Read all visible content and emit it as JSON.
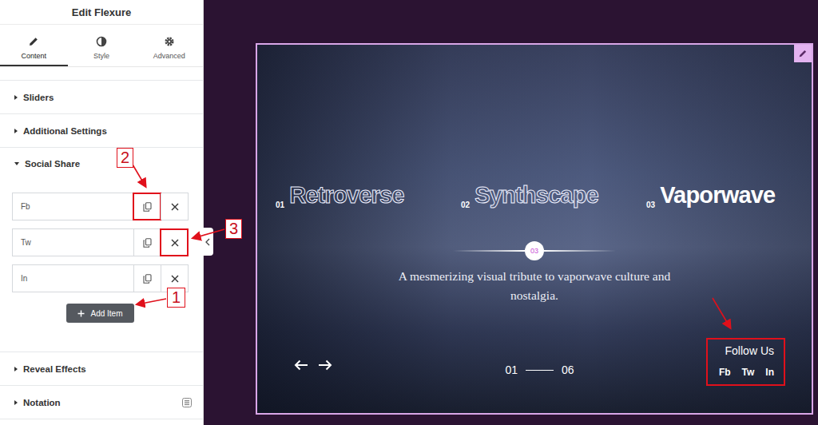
{
  "panel": {
    "title": "Edit Flexure",
    "tabs": [
      {
        "label": "Content",
        "selected": true
      },
      {
        "label": "Style",
        "selected": false
      },
      {
        "label": "Advanced",
        "selected": false
      }
    ],
    "sections": [
      {
        "label": "Sliders",
        "expanded": false,
        "pro": false
      },
      {
        "label": "Additional Settings",
        "expanded": false,
        "pro": false
      },
      {
        "label": "Social Share",
        "expanded": true,
        "pro": false,
        "items": [
          {
            "label": "Fb",
            "copy_highlighted": true,
            "remove_highlighted": false
          },
          {
            "label": "Tw",
            "copy_highlighted": false,
            "remove_highlighted": true
          },
          {
            "label": "In",
            "copy_highlighted": false,
            "remove_highlighted": false
          }
        ],
        "add_button": "Add Item"
      },
      {
        "label": "Reveal Effects",
        "expanded": false,
        "pro": false
      },
      {
        "label": "Notation",
        "expanded": false,
        "pro": true
      }
    ]
  },
  "annotations": [
    {
      "label": "1"
    },
    {
      "label": "2"
    },
    {
      "label": "3"
    }
  ],
  "preview": {
    "slides": [
      {
        "number": "01",
        "title": "Retroverse",
        "selected": false
      },
      {
        "number": "02",
        "title": "Synthscape",
        "selected": false
      },
      {
        "number": "03",
        "title": "Vaporwave",
        "selected": true
      }
    ],
    "progress": {
      "current": "03"
    },
    "description": "A mesmerizing visual tribute to vaporwave culture and nostalgia.",
    "pagination": {
      "current": "01",
      "total": "06"
    },
    "social": {
      "heading": "Follow Us",
      "links": [
        "Fb",
        "Tw",
        "In"
      ],
      "highlighted": true
    }
  }
}
